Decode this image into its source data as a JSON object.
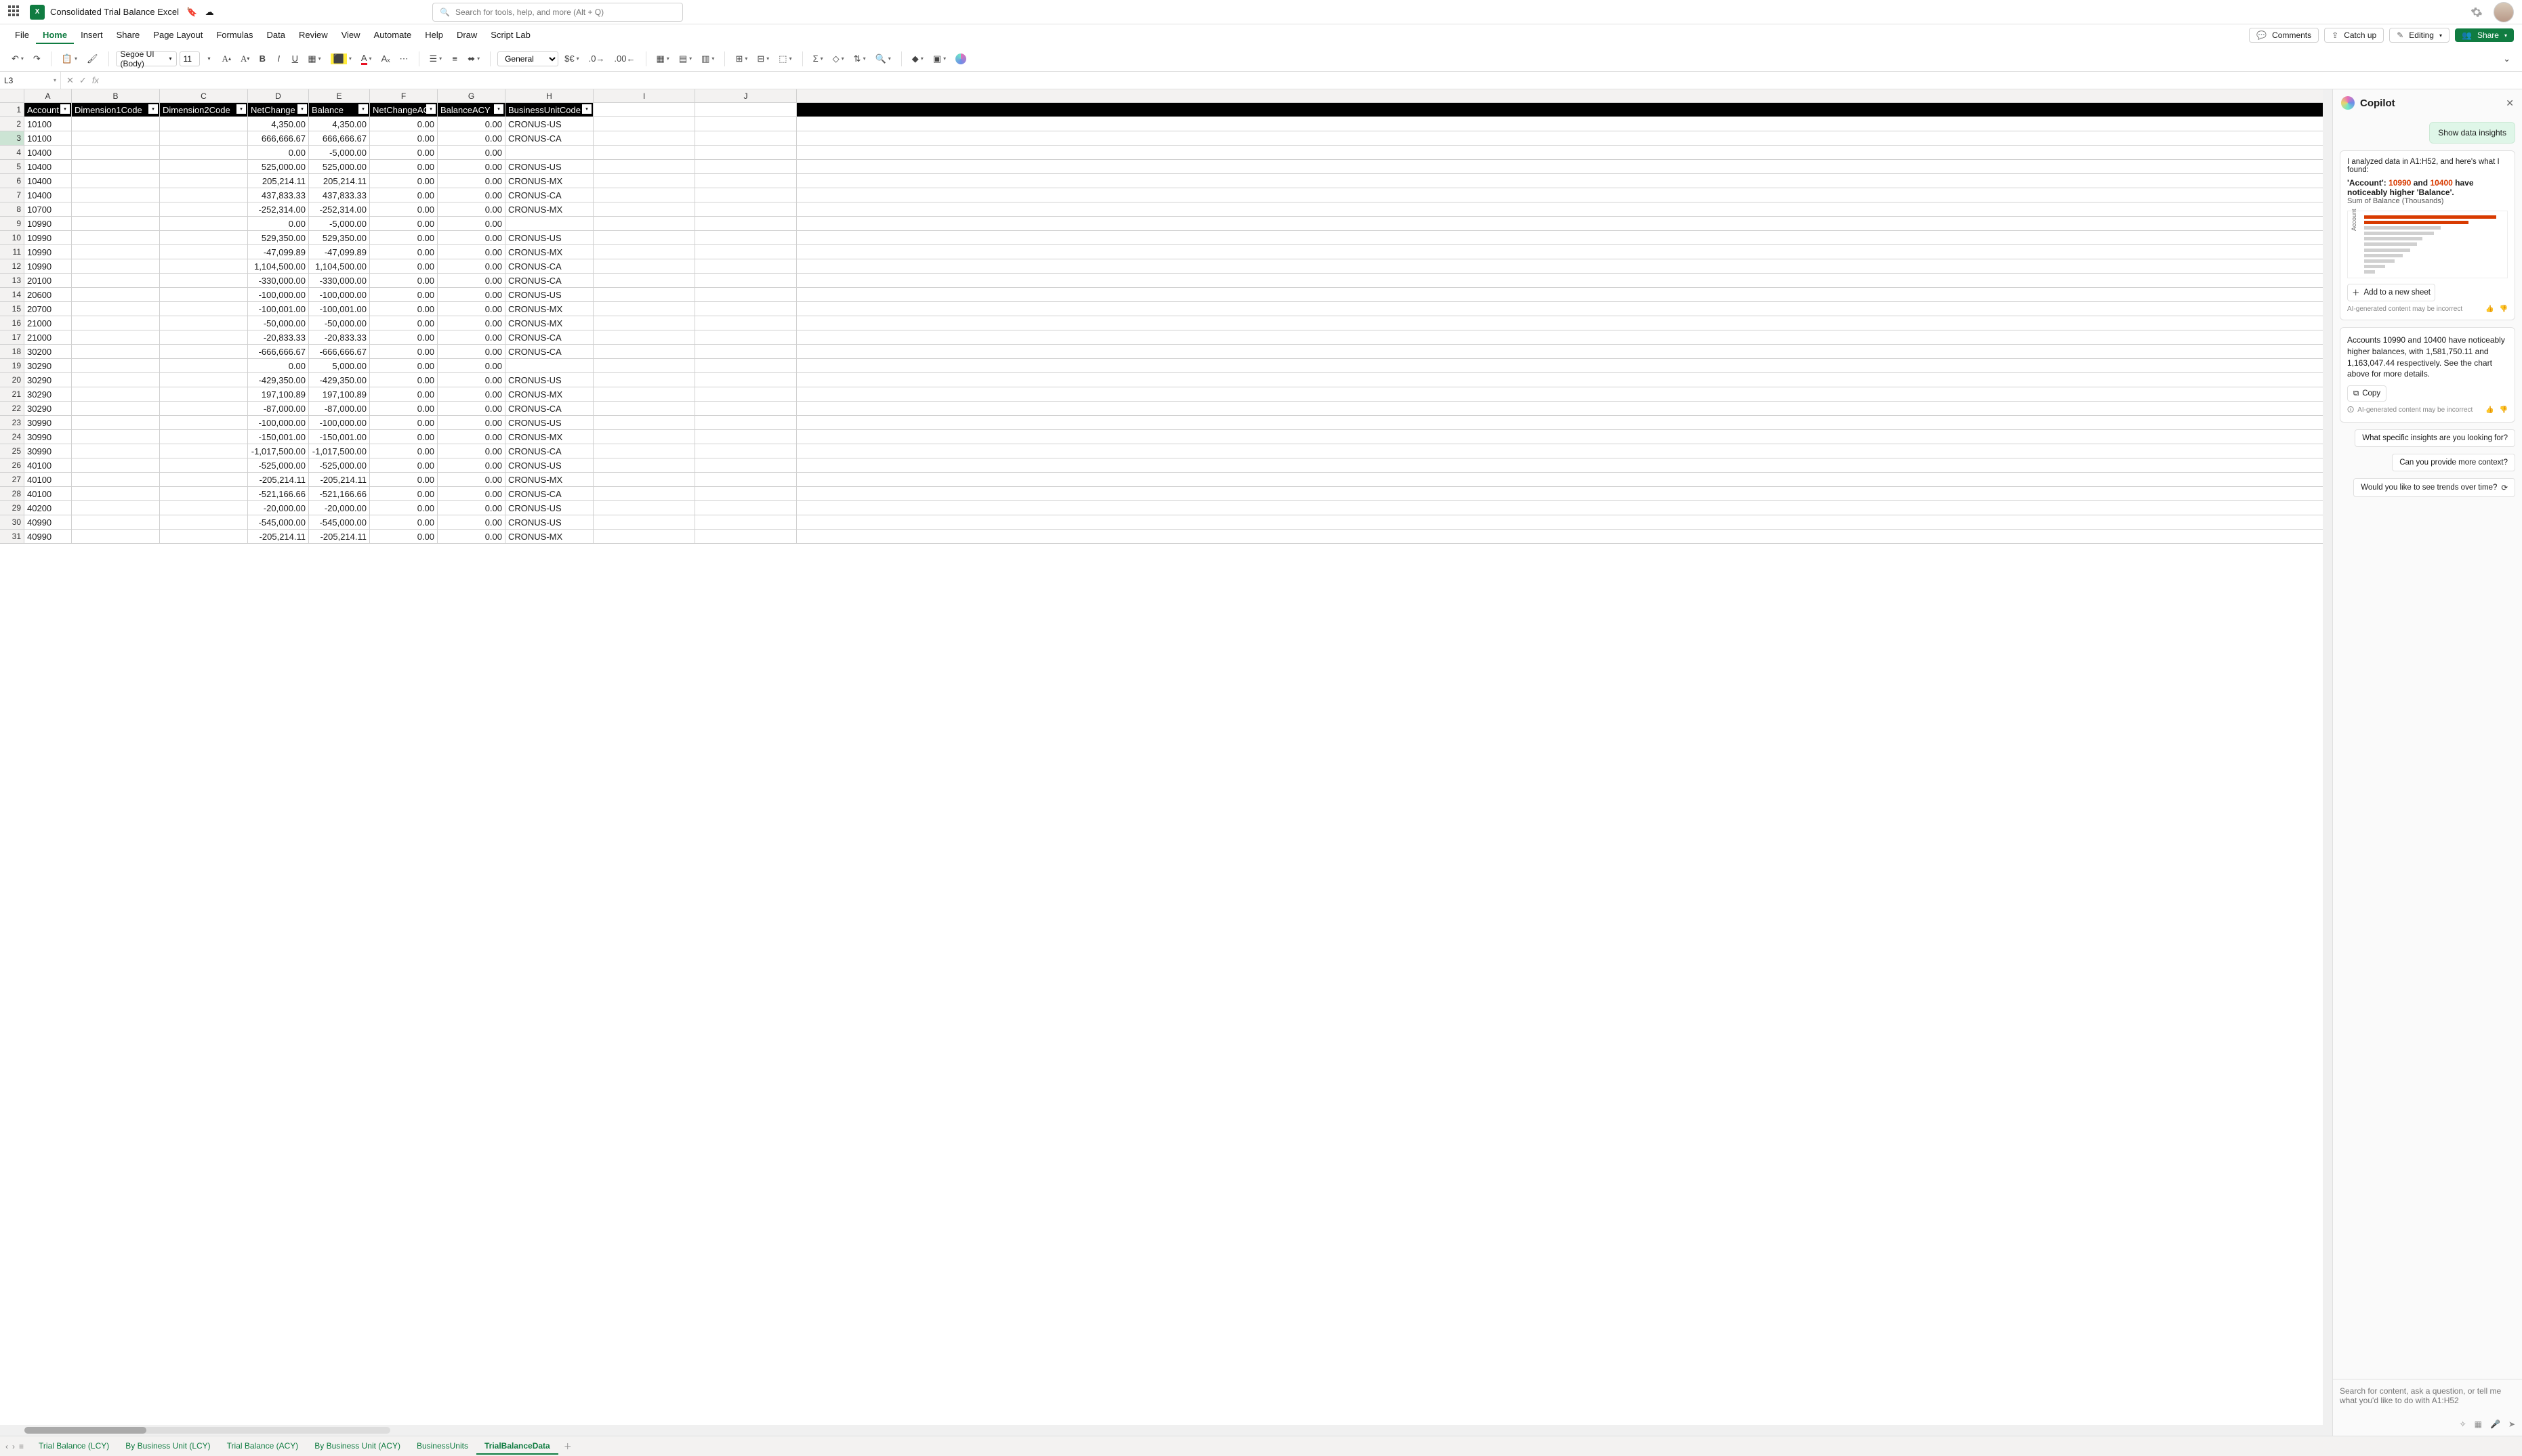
{
  "title": "Consolidated Trial Balance Excel",
  "search_placeholder": "Search for tools, help, and more (Alt + Q)",
  "menus": [
    "File",
    "Home",
    "Insert",
    "Share",
    "Page Layout",
    "Formulas",
    "Data",
    "Review",
    "View",
    "Automate",
    "Help",
    "Draw",
    "Script Lab"
  ],
  "active_menu": "Home",
  "right_buttons": {
    "comments": "Comments",
    "catchup": "Catch up",
    "editing": "Editing",
    "share": "Share"
  },
  "font_name": "Segoe UI (Body)",
  "font_size": "11",
  "number_format": "General",
  "namebox": "L3",
  "columns": [
    "A",
    "B",
    "C",
    "D",
    "E",
    "F",
    "G",
    "H",
    "I",
    "J"
  ],
  "headers": [
    "Account",
    "Dimension1Code",
    "Dimension2Code",
    "NetChange",
    "Balance",
    "NetChangeACY",
    "BalanceACY",
    "BusinessUnitCode"
  ],
  "rows": [
    {
      "a": "10100",
      "d": "4,350.00",
      "e": "4,350.00",
      "f": "0.00",
      "g": "0.00",
      "h": "CRONUS-US"
    },
    {
      "a": "10100",
      "d": "666,666.67",
      "e": "666,666.67",
      "f": "0.00",
      "g": "0.00",
      "h": "CRONUS-CA"
    },
    {
      "a": "10400",
      "d": "0.00",
      "e": "-5,000.00",
      "f": "0.00",
      "g": "0.00",
      "h": ""
    },
    {
      "a": "10400",
      "d": "525,000.00",
      "e": "525,000.00",
      "f": "0.00",
      "g": "0.00",
      "h": "CRONUS-US"
    },
    {
      "a": "10400",
      "d": "205,214.11",
      "e": "205,214.11",
      "f": "0.00",
      "g": "0.00",
      "h": "CRONUS-MX"
    },
    {
      "a": "10400",
      "d": "437,833.33",
      "e": "437,833.33",
      "f": "0.00",
      "g": "0.00",
      "h": "CRONUS-CA"
    },
    {
      "a": "10700",
      "d": "-252,314.00",
      "e": "-252,314.00",
      "f": "0.00",
      "g": "0.00",
      "h": "CRONUS-MX"
    },
    {
      "a": "10990",
      "d": "0.00",
      "e": "-5,000.00",
      "f": "0.00",
      "g": "0.00",
      "h": ""
    },
    {
      "a": "10990",
      "d": "529,350.00",
      "e": "529,350.00",
      "f": "0.00",
      "g": "0.00",
      "h": "CRONUS-US"
    },
    {
      "a": "10990",
      "d": "-47,099.89",
      "e": "-47,099.89",
      "f": "0.00",
      "g": "0.00",
      "h": "CRONUS-MX"
    },
    {
      "a": "10990",
      "d": "1,104,500.00",
      "e": "1,104,500.00",
      "f": "0.00",
      "g": "0.00",
      "h": "CRONUS-CA"
    },
    {
      "a": "20100",
      "d": "-330,000.00",
      "e": "-330,000.00",
      "f": "0.00",
      "g": "0.00",
      "h": "CRONUS-CA"
    },
    {
      "a": "20600",
      "d": "-100,000.00",
      "e": "-100,000.00",
      "f": "0.00",
      "g": "0.00",
      "h": "CRONUS-US"
    },
    {
      "a": "20700",
      "d": "-100,001.00",
      "e": "-100,001.00",
      "f": "0.00",
      "g": "0.00",
      "h": "CRONUS-MX"
    },
    {
      "a": "21000",
      "d": "-50,000.00",
      "e": "-50,000.00",
      "f": "0.00",
      "g": "0.00",
      "h": "CRONUS-MX"
    },
    {
      "a": "21000",
      "d": "-20,833.33",
      "e": "-20,833.33",
      "f": "0.00",
      "g": "0.00",
      "h": "CRONUS-CA"
    },
    {
      "a": "30200",
      "d": "-666,666.67",
      "e": "-666,666.67",
      "f": "0.00",
      "g": "0.00",
      "h": "CRONUS-CA"
    },
    {
      "a": "30290",
      "d": "0.00",
      "e": "5,000.00",
      "f": "0.00",
      "g": "0.00",
      "h": ""
    },
    {
      "a": "30290",
      "d": "-429,350.00",
      "e": "-429,350.00",
      "f": "0.00",
      "g": "0.00",
      "h": "CRONUS-US"
    },
    {
      "a": "30290",
      "d": "197,100.89",
      "e": "197,100.89",
      "f": "0.00",
      "g": "0.00",
      "h": "CRONUS-MX"
    },
    {
      "a": "30290",
      "d": "-87,000.00",
      "e": "-87,000.00",
      "f": "0.00",
      "g": "0.00",
      "h": "CRONUS-CA"
    },
    {
      "a": "30990",
      "d": "-100,000.00",
      "e": "-100,000.00",
      "f": "0.00",
      "g": "0.00",
      "h": "CRONUS-US"
    },
    {
      "a": "30990",
      "d": "-150,001.00",
      "e": "-150,001.00",
      "f": "0.00",
      "g": "0.00",
      "h": "CRONUS-MX"
    },
    {
      "a": "30990",
      "d": "-1,017,500.00",
      "e": "-1,017,500.00",
      "f": "0.00",
      "g": "0.00",
      "h": "CRONUS-CA"
    },
    {
      "a": "40100",
      "d": "-525,000.00",
      "e": "-525,000.00",
      "f": "0.00",
      "g": "0.00",
      "h": "CRONUS-US"
    },
    {
      "a": "40100",
      "d": "-205,214.11",
      "e": "-205,214.11",
      "f": "0.00",
      "g": "0.00",
      "h": "CRONUS-MX"
    },
    {
      "a": "40100",
      "d": "-521,166.66",
      "e": "-521,166.66",
      "f": "0.00",
      "g": "0.00",
      "h": "CRONUS-CA"
    },
    {
      "a": "40200",
      "d": "-20,000.00",
      "e": "-20,000.00",
      "f": "0.00",
      "g": "0.00",
      "h": "CRONUS-US"
    },
    {
      "a": "40990",
      "d": "-545,000.00",
      "e": "-545,000.00",
      "f": "0.00",
      "g": "0.00",
      "h": "CRONUS-US"
    },
    {
      "a": "40990",
      "d": "-205,214.11",
      "e": "-205,214.11",
      "f": "0.00",
      "g": "0.00",
      "h": "CRONUS-MX"
    }
  ],
  "copilot": {
    "title": "Copilot",
    "user_msg": "Show data insights",
    "intro": "I analyzed data in A1:H52, and here's what I found:",
    "bold_prefix": "'Account': ",
    "acc1": "10990",
    "mid": " and ",
    "acc2": "10400",
    "bold_suffix": " have noticeably higher 'Balance'.",
    "sub": "Sum of Balance (Thousands)",
    "ylab": "Account",
    "add_sheet": "Add to a new sheet",
    "ai_note": "AI-generated content may be incorrect",
    "text2": "Accounts 10990 and 10400 have noticeably higher balances, with 1,581,750.11 and 1,163,047.44 respectively. See the chart above for more details.",
    "copy": "Copy",
    "sugg1": "What specific insights are you looking for?",
    "sugg2": "Can you provide more context?",
    "sugg3": "Would you like to see trends over time?",
    "input_placeholder": "Search for content, ask a question, or tell me what you'd like to do with A1:H52"
  },
  "sheets": [
    "Trial Balance (LCY)",
    "By Business Unit (LCY)",
    "Trial Balance (ACY)",
    "By Business Unit (ACY)",
    "BusinessUnits",
    "TrialBalanceData"
  ],
  "active_sheet": "TrialBalanceData",
  "chart_data": {
    "type": "bar",
    "orientation": "horizontal",
    "ylabel": "Account",
    "title": "Sum of Balance (Thousands)",
    "highlight_accounts": [
      "10990",
      "10400"
    ],
    "bars": [
      {
        "w": 95,
        "hl": true
      },
      {
        "w": 75,
        "hl": true
      },
      {
        "w": 55,
        "hl": false
      },
      {
        "w": 50,
        "hl": false
      },
      {
        "w": 42,
        "hl": false
      },
      {
        "w": 38,
        "hl": false
      },
      {
        "w": 33,
        "hl": false
      },
      {
        "w": 28,
        "hl": false
      },
      {
        "w": 22,
        "hl": false
      },
      {
        "w": 15,
        "hl": false
      },
      {
        "w": 8,
        "hl": false
      }
    ]
  }
}
